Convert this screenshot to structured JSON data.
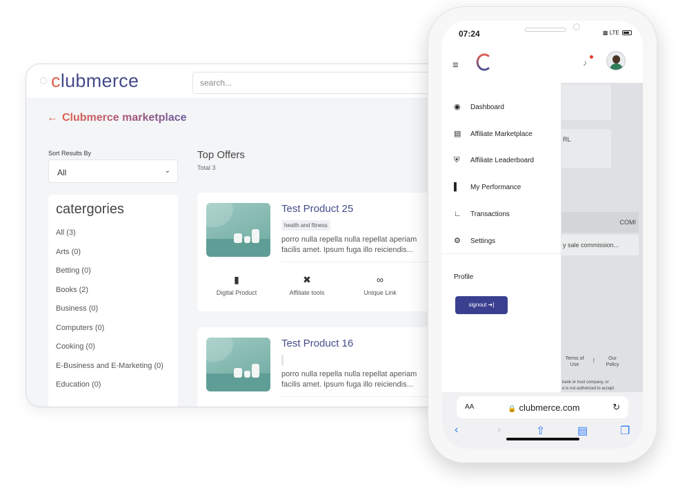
{
  "desktop": {
    "logo": {
      "c": "c",
      "rest": "lubmerce"
    },
    "search_placeholder": "search...",
    "back_arrow": "←",
    "page_title": "Clubmerce marketplace",
    "sort": {
      "label": "Sort Results By",
      "value": "All"
    },
    "categories": {
      "title": "catergories",
      "items": [
        "All (3)",
        "Arts (0)",
        "Betting (0)",
        "Books (2)",
        "Business (0)",
        "Computers (0)",
        "Cooking (0)",
        "E-Business and E-Marketing (0)",
        "Education (0)"
      ]
    },
    "offers": {
      "title": "Top Offers",
      "total": "Total 3"
    },
    "products": [
      {
        "name": "Test Product 25",
        "tag": "health and fitness",
        "desc1": "porro nulla repella nulla repellat aperiam",
        "desc2": "facilis amet. Ipsum fuga illo reiciendis..."
      },
      {
        "name": "Test Product 16",
        "tag": "",
        "desc1": "porro nulla repella nulla repellat aperiam",
        "desc2": "facilis amet. Ipsum fuga illo reiciendis..."
      }
    ],
    "features": [
      {
        "icon": "document-icon",
        "label": "Digital Product"
      },
      {
        "icon": "tools-icon",
        "label": "Affiliate tools"
      },
      {
        "icon": "link-icon",
        "label": "Unique Link"
      }
    ]
  },
  "phone": {
    "time": "07:24",
    "network": "LTE",
    "menu": [
      {
        "icon": "globe-icon",
        "label": "Dashboard"
      },
      {
        "icon": "store-icon",
        "label": "Affiliate Marketplace"
      },
      {
        "icon": "trophy-icon",
        "label": "Affiliate Leaderboard"
      },
      {
        "icon": "bar-chart-icon",
        "label": "My Performance"
      },
      {
        "icon": "line-chart-icon",
        "label": "Transactions"
      },
      {
        "icon": "gear-icon",
        "label": "Settings"
      }
    ],
    "profile_label": "Profile",
    "signout_label": "signout ➜]",
    "background": {
      "url_fragment": "RL",
      "column_header": "COMI",
      "commission_text": "y sale commission...",
      "terms": "Terms of Use",
      "policy": "Our Policy",
      "separator": "|",
      "fine_print_1": "bank or trust company, or",
      "fine_print_2": "e is not authorized to accept"
    },
    "browser": {
      "aa": "AA",
      "domain": "clubmerce.com"
    }
  },
  "colors": {
    "brand_orange": "#e05f4f",
    "brand_indigo": "#454b8a",
    "signout_bg": "#3a3f8f"
  }
}
